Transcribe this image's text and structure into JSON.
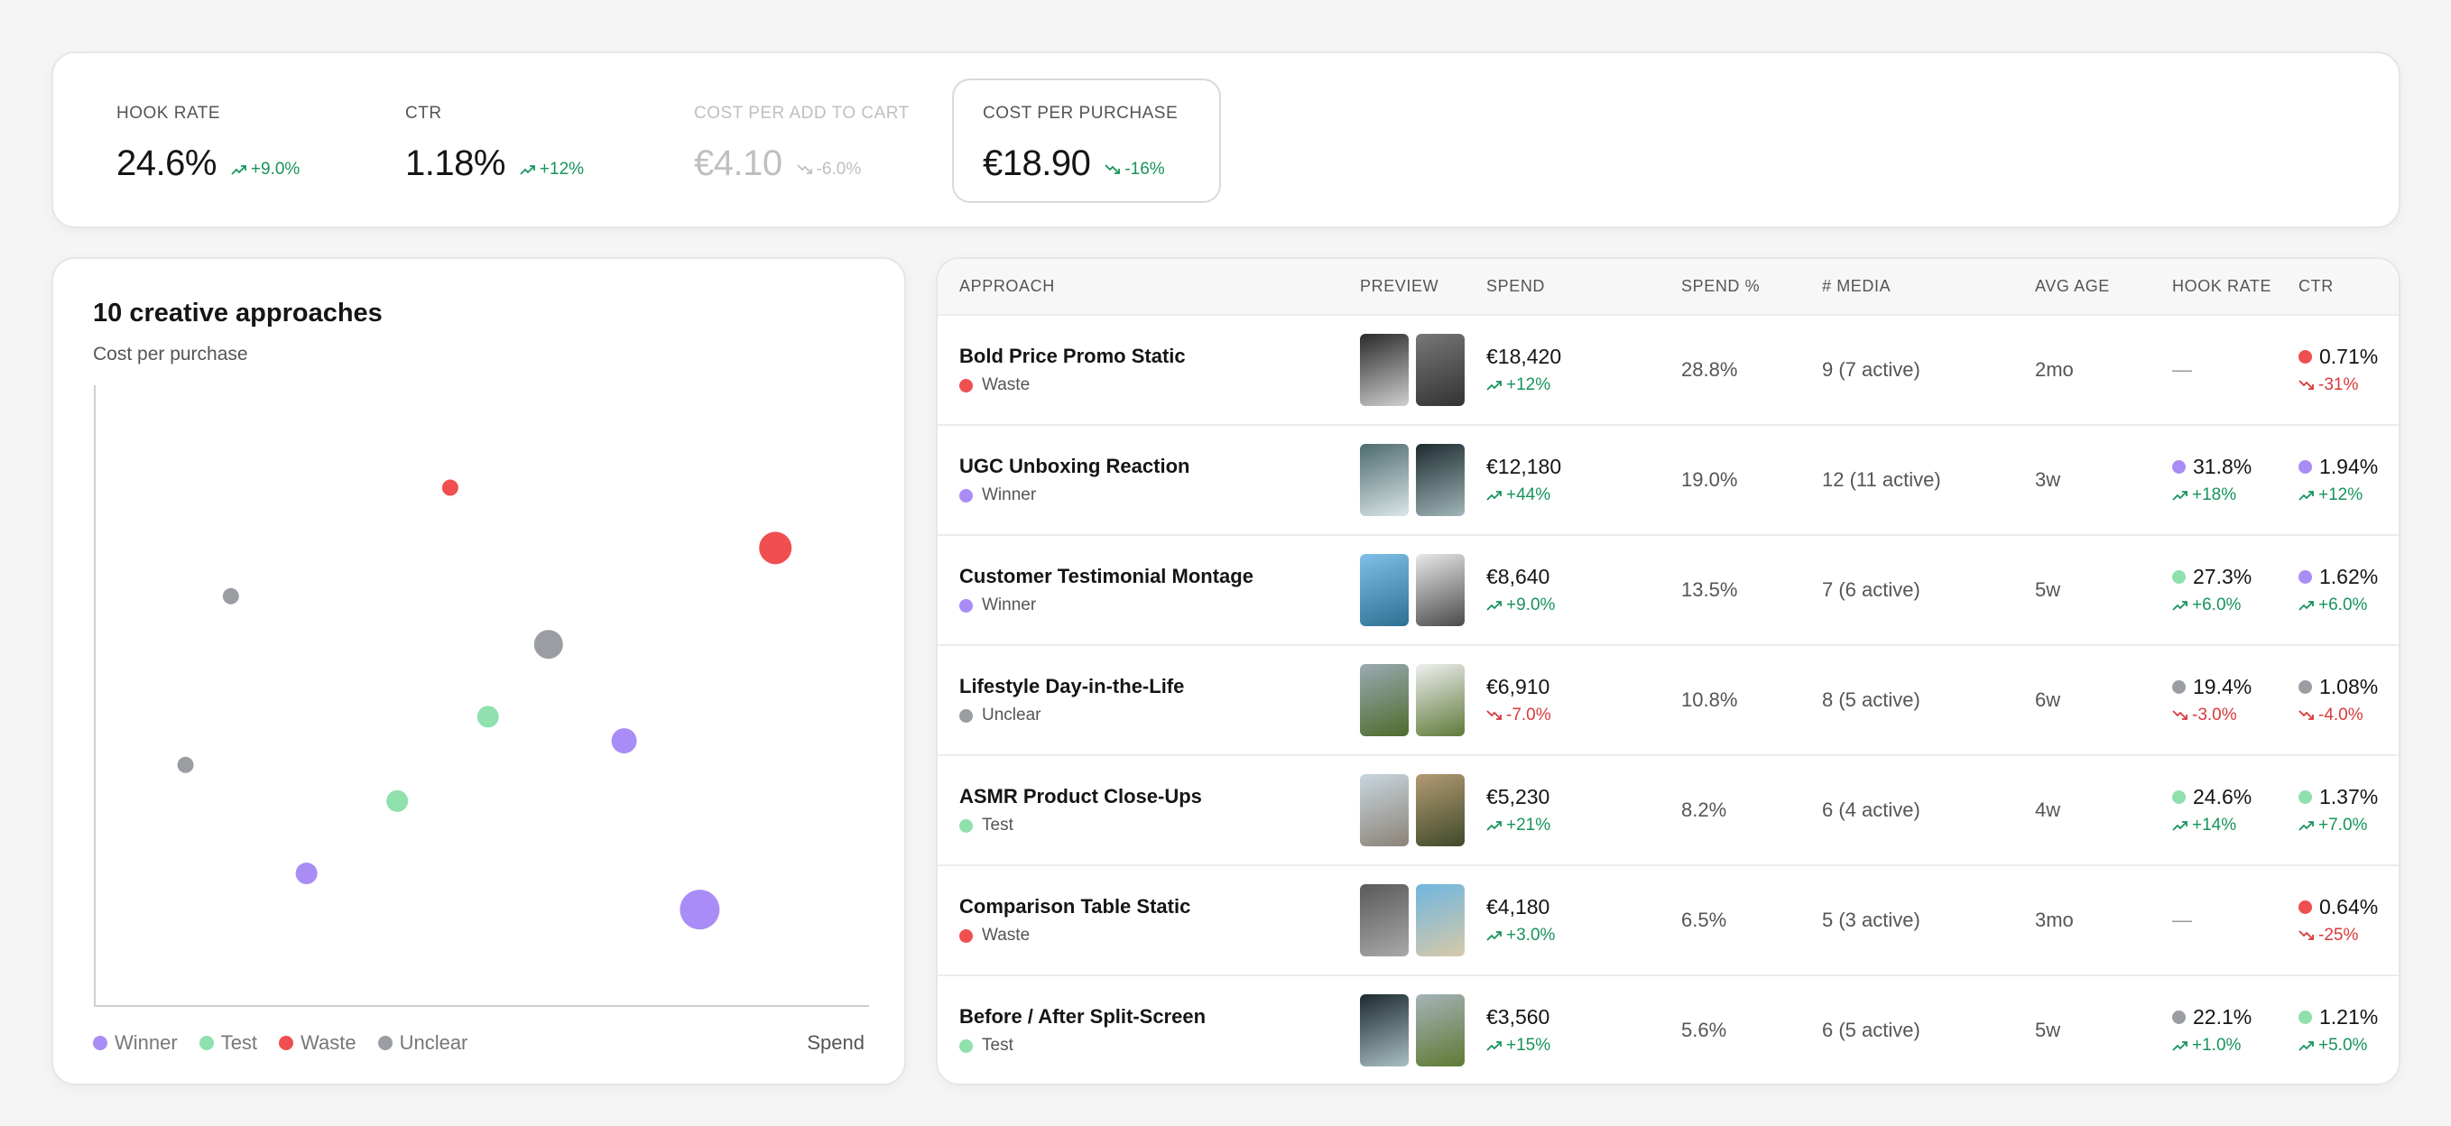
{
  "colors": {
    "winner": "#a98cf5",
    "test": "#8fe0ad",
    "waste": "#ef4f4f",
    "unclear": "#9a9ea3",
    "up": "#17935b",
    "down": "#d8393b"
  },
  "kpis": [
    {
      "label": "HOOK RATE",
      "value": "24.6%",
      "delta": "+9.0%",
      "dir": "up",
      "state": "normal"
    },
    {
      "label": "CTR",
      "value": "1.18%",
      "delta": "+12%",
      "dir": "up",
      "state": "normal"
    },
    {
      "label": "COST PER ADD TO CART",
      "value": "€4.10",
      "delta": "-6.0%",
      "dir": "down",
      "state": "dim"
    },
    {
      "label": "COST PER PURCHASE",
      "value": "€18.90",
      "delta": "-16%",
      "dir": "down-good",
      "state": "selected"
    }
  ],
  "scatter": {
    "title": "10 creative approaches",
    "subtitle": "Cost per purchase",
    "x_label": "Spend",
    "legend": [
      {
        "label": "Winner",
        "key": "winner"
      },
      {
        "label": "Test",
        "key": "test"
      },
      {
        "label": "Waste",
        "key": "waste"
      },
      {
        "label": "Unclear",
        "key": "unclear"
      }
    ]
  },
  "chart_data": {
    "type": "scatter",
    "xlabel": "Spend",
    "ylabel": "Cost per purchase",
    "xlim": [
      0,
      100
    ],
    "ylim": [
      0,
      100
    ],
    "grid": false,
    "legend_position": "bottom-left",
    "points": [
      {
        "x": 47,
        "y": 86,
        "size": 9,
        "group": "waste"
      },
      {
        "x": 90,
        "y": 76,
        "size": 18,
        "group": "waste"
      },
      {
        "x": 18,
        "y": 68,
        "size": 9,
        "group": "unclear"
      },
      {
        "x": 60,
        "y": 60,
        "size": 16,
        "group": "unclear"
      },
      {
        "x": 52,
        "y": 48,
        "size": 12,
        "group": "test"
      },
      {
        "x": 70,
        "y": 44,
        "size": 14,
        "group": "winner"
      },
      {
        "x": 12,
        "y": 40,
        "size": 9,
        "group": "unclear"
      },
      {
        "x": 40,
        "y": 34,
        "size": 12,
        "group": "test"
      },
      {
        "x": 28,
        "y": 22,
        "size": 12,
        "group": "winner"
      },
      {
        "x": 80,
        "y": 16,
        "size": 22,
        "group": "winner"
      }
    ]
  },
  "table": {
    "columns": [
      "APPROACH",
      "PREVIEW",
      "SPEND",
      "SPEND %",
      "# MEDIA",
      "AVG AGE",
      "HOOK RATE",
      "CTR"
    ],
    "rows": [
      {
        "name": "Bold Price Promo Static",
        "status": "Waste",
        "status_key": "waste",
        "thumbs": [
          {
            "c1": "#2a2a2a",
            "c2": "#cfcfcf"
          },
          {
            "c1": "#777",
            "c2": "#333"
          }
        ],
        "spend": "€18,420",
        "spend_delta": "+12%",
        "spend_dir": "up",
        "spend_pct": "28.8%",
        "media": "9 (7 active)",
        "age": "2mo",
        "hook": null,
        "ctr": {
          "value": "0.71%",
          "key": "waste",
          "delta": "-31%",
          "dir": "down"
        }
      },
      {
        "name": "UGC Unboxing Reaction",
        "status": "Winner",
        "status_key": "winner",
        "thumbs": [
          {
            "c1": "#4d6b6e",
            "c2": "#dbe6e8"
          },
          {
            "c1": "#1d2b2f",
            "c2": "#9fb5b8"
          }
        ],
        "spend": "€12,180",
        "spend_delta": "+44%",
        "spend_dir": "up",
        "spend_pct": "19.0%",
        "media": "12 (11 active)",
        "age": "3w",
        "hook": {
          "value": "31.8%",
          "key": "winner",
          "delta": "+18%",
          "dir": "up"
        },
        "ctr": {
          "value": "1.94%",
          "key": "winner",
          "delta": "+12%",
          "dir": "up"
        }
      },
      {
        "name": "Customer Testimonial Montage",
        "status": "Winner",
        "status_key": "winner",
        "thumbs": [
          {
            "c1": "#7fc0e8",
            "c2": "#2e6f93"
          },
          {
            "c1": "#e8e8e8",
            "c2": "#4a4a4a"
          }
        ],
        "spend": "€8,640",
        "spend_delta": "+9.0%",
        "spend_dir": "up",
        "spend_pct": "13.5%",
        "media": "7 (6 active)",
        "age": "5w",
        "hook": {
          "value": "27.3%",
          "key": "test",
          "delta": "+6.0%",
          "dir": "up"
        },
        "ctr": {
          "value": "1.62%",
          "key": "winner",
          "delta": "+6.0%",
          "dir": "up"
        }
      },
      {
        "name": "Lifestyle Day-in-the-Life",
        "status": "Unclear",
        "status_key": "unclear",
        "thumbs": [
          {
            "c1": "#9aaab3",
            "c2": "#4f6b2c"
          },
          {
            "c1": "#efefef",
            "c2": "#5f7a3a"
          }
        ],
        "spend": "€6,910",
        "spend_delta": "-7.0%",
        "spend_dir": "down",
        "spend_pct": "10.8%",
        "media": "8 (5 active)",
        "age": "6w",
        "hook": {
          "value": "19.4%",
          "key": "unclear",
          "delta": "-3.0%",
          "dir": "down"
        },
        "ctr": {
          "value": "1.08%",
          "key": "unclear",
          "delta": "-4.0%",
          "dir": "down"
        }
      },
      {
        "name": "ASMR Product Close-Ups",
        "status": "Test",
        "status_key": "test",
        "thumbs": [
          {
            "c1": "#c9d6de",
            "c2": "#8b8378"
          },
          {
            "c1": "#b39a74",
            "c2": "#3f4a2a"
          }
        ],
        "spend": "€5,230",
        "spend_delta": "+21%",
        "spend_dir": "up",
        "spend_pct": "8.2%",
        "media": "6 (4 active)",
        "age": "4w",
        "hook": {
          "value": "24.6%",
          "key": "test",
          "delta": "+14%",
          "dir": "up"
        },
        "ctr": {
          "value": "1.37%",
          "key": "test",
          "delta": "+7.0%",
          "dir": "up"
        }
      },
      {
        "name": "Comparison Table Static",
        "status": "Waste",
        "status_key": "waste",
        "thumbs": [
          {
            "c1": "#5a5a5a",
            "c2": "#a8a8a8"
          },
          {
            "c1": "#6fb6e0",
            "c2": "#d7c9a8"
          }
        ],
        "spend": "€4,180",
        "spend_delta": "+3.0%",
        "spend_dir": "up",
        "spend_pct": "6.5%",
        "media": "5 (3 active)",
        "age": "3mo",
        "hook": null,
        "ctr": {
          "value": "0.64%",
          "key": "waste",
          "delta": "-25%",
          "dir": "down"
        }
      },
      {
        "name": "Before / After Split-Screen",
        "status": "Test",
        "status_key": "test",
        "thumbs": [
          {
            "c1": "#1c2a2e",
            "c2": "#a9bfc3"
          },
          {
            "c1": "#a5b3b8",
            "c2": "#5e7a33"
          }
        ],
        "spend": "€3,560",
        "spend_delta": "+15%",
        "spend_dir": "up",
        "spend_pct": "5.6%",
        "media": "6 (5 active)",
        "age": "5w",
        "hook": {
          "value": "22.1%",
          "key": "unclear",
          "delta": "+1.0%",
          "dir": "up"
        },
        "ctr": {
          "value": "1.21%",
          "key": "test",
          "delta": "+5.0%",
          "dir": "up"
        }
      }
    ],
    "empty_value": "—"
  }
}
